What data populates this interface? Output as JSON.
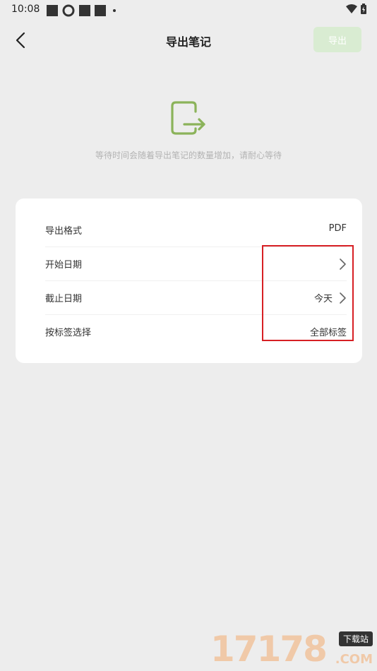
{
  "status_bar": {
    "time": "10:08"
  },
  "header": {
    "title": "导出笔记",
    "export_label": "导出"
  },
  "hint": "等待时间会随着导出笔记的数量增加，请耐心等待",
  "settings": {
    "rows": [
      {
        "label": "导出格式",
        "value": "PDF"
      },
      {
        "label": "开始日期",
        "value": ""
      },
      {
        "label": "截止日期",
        "value": "今天"
      },
      {
        "label": "按标签选择",
        "value": "全部标签"
      }
    ]
  },
  "watermark": {
    "digits": "17178",
    "tag": "下载站",
    "com": ".COM"
  },
  "colors": {
    "accent": "#8bb35a",
    "export_btn_bg": "#d9ecd2",
    "highlight": "#d71f24",
    "background": "#ededed"
  },
  "icons": {
    "back": "chevron-left-icon",
    "export": "export-arrow-icon",
    "row_chevron": "chevron-right-icon"
  }
}
